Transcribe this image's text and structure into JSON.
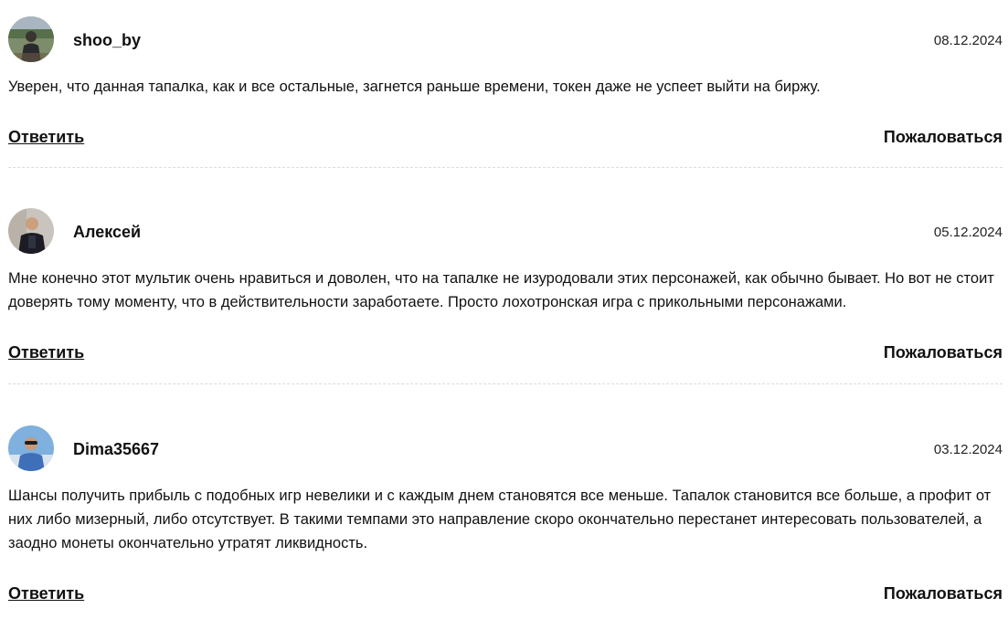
{
  "comments": [
    {
      "username": "shoo_by",
      "date": "08.12.2024",
      "text": "Уверен, что данная тапалка, как и все остальные, загнется раньше времени, токен даже не успеет выйти на биржу.",
      "reply_label": "Ответить",
      "report_label": "Пожаловаться",
      "avatar_icon": "user-avatar"
    },
    {
      "username": "Алексей",
      "date": "05.12.2024",
      "text": "Мне конечно этот мультик очень нравиться и доволен, что на тапалке не изуродовали этих персонажей, как обычно бывает. Но вот не стоит доверять тому моменту, что в действительности заработаете. Просто лохотронская игра с прикольными персонажами.",
      "reply_label": "Ответить",
      "report_label": "Пожаловаться",
      "avatar_icon": "user-avatar"
    },
    {
      "username": "Dima35667",
      "date": "03.12.2024",
      "text": "Шансы получить прибыль с подобных игр невелики и с каждым днем становятся все меньше. Тапалок становится все больше, а профит от них либо мизерный, либо отсутствует. В такими темпами это направление скоро окончательно перестанет интересовать пользователей, а заодно монеты окончательно утратят ликвидность.",
      "reply_label": "Ответить",
      "report_label": "Пожаловаться",
      "avatar_icon": "user-avatar"
    }
  ]
}
